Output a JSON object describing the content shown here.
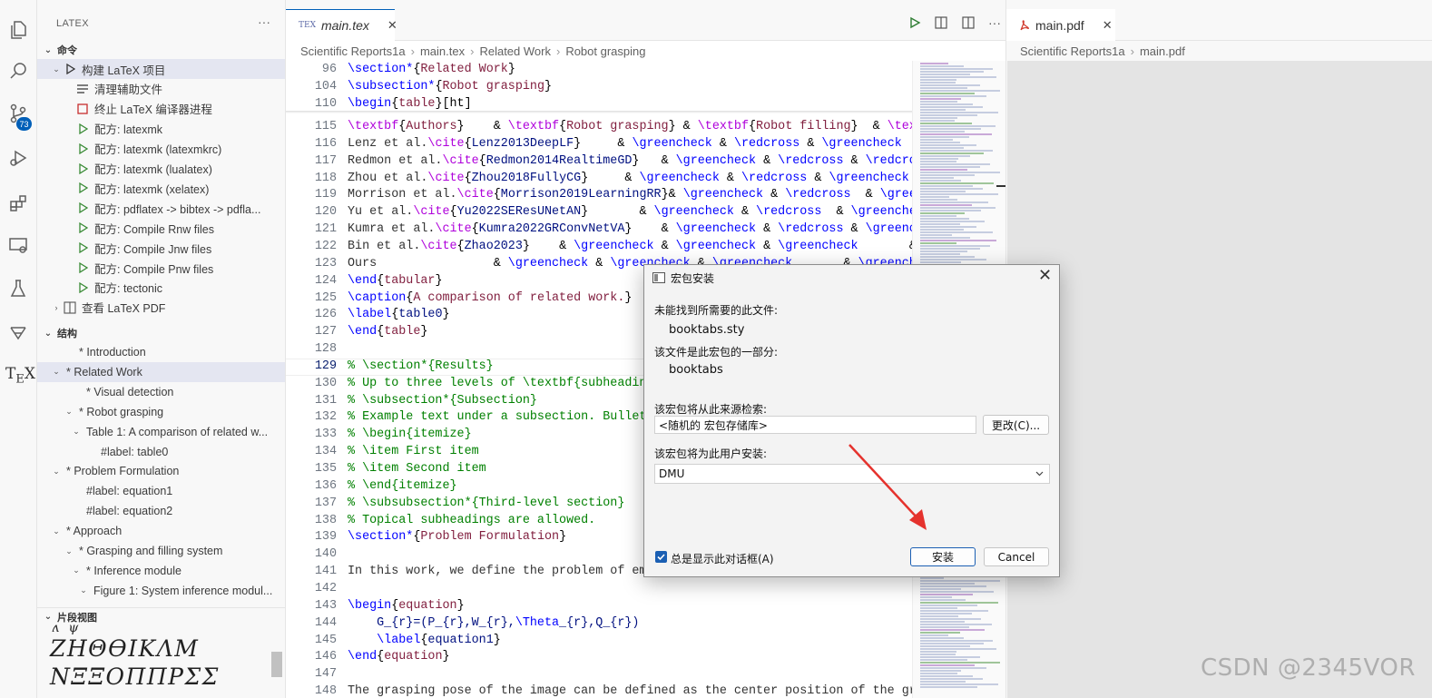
{
  "sidebar": {
    "title": "LATEX",
    "more": "···",
    "badge": "73",
    "commands_header": "命令",
    "commands": [
      {
        "label": "构建 LaTeX 项目",
        "icon": "play-outline-icon"
      },
      {
        "label": "清理辅助文件",
        "icon": "list-icon"
      },
      {
        "label": "终止 LaTeX 编译器进程",
        "icon": "stop-icon"
      },
      {
        "label": "配方: latexmk",
        "icon": "play-icon"
      },
      {
        "label": "配方: latexmk (latexmkrc)",
        "icon": "play-icon"
      },
      {
        "label": "配方: latexmk (lualatex)",
        "icon": "play-icon"
      },
      {
        "label": "配方: latexmk (xelatex)",
        "icon": "play-icon"
      },
      {
        "label": "配方: pdflatex -> bibtex -> pdfla...",
        "icon": "play-icon"
      },
      {
        "label": "配方: Compile Rnw files",
        "icon": "play-icon"
      },
      {
        "label": "配方: Compile Jnw files",
        "icon": "play-icon"
      },
      {
        "label": "配方: Compile Pnw files",
        "icon": "play-icon"
      },
      {
        "label": "配方: tectonic",
        "icon": "play-icon"
      },
      {
        "label": "查看 LaTeX PDF",
        "icon": "pdf-view-icon"
      }
    ],
    "structure_header": "结构",
    "structure": [
      {
        "label": "* Introduction"
      },
      {
        "label": "* Related Work"
      },
      {
        "label": "* Visual detection"
      },
      {
        "label": "* Robot grasping"
      },
      {
        "label": "Table 1: A comparison of related w..."
      },
      {
        "label": "#label: table0"
      },
      {
        "label": "* Problem Formulation"
      },
      {
        "label": "#label: equation1"
      },
      {
        "label": "#label: equation2"
      },
      {
        "label": "* Approach"
      },
      {
        "label": "* Grasping and filling system"
      },
      {
        "label": "* Inference module"
      },
      {
        "label": "Figure 1: System inference modul..."
      }
    ],
    "snippet_header": "片段视图",
    "snippet_row1": "ʌ ψ ˜ ˆ ˘ ˙ ˇ ¯ ¯ ˜",
    "snippet_row2": "ZHΘϴIKΛM",
    "snippet_row3": "NΞΞOΠΠΡΣΣ"
  },
  "editor": {
    "tab_label": "main.tex",
    "tab_tex": "TEX",
    "close": "✕",
    "toolbar_more": "···",
    "breadcrumb": [
      "Scientific Reports1a",
      "main.tex",
      "Related Work",
      "Robot grasping"
    ],
    "sticky": [
      {
        "n": "96",
        "parts": [
          [
            "\\section*",
            "k"
          ],
          [
            "{",
            "pl"
          ],
          [
            "Related Work",
            "b"
          ],
          [
            "}",
            "pl"
          ]
        ]
      },
      {
        "n": "104",
        "parts": [
          [
            "\\subsection*",
            "k"
          ],
          [
            "{",
            "pl"
          ],
          [
            "Robot grasping",
            "b"
          ],
          [
            "}",
            "pl"
          ]
        ]
      },
      {
        "n": "110",
        "parts": [
          [
            "\\begin",
            "k"
          ],
          [
            "{",
            "pl"
          ],
          [
            "table",
            "b"
          ],
          [
            "}[ht]",
            "pl"
          ]
        ]
      }
    ],
    "lines": [
      {
        "n": "115",
        "parts": [
          [
            "\\textbf",
            "m"
          ],
          [
            "{",
            "pl"
          ],
          [
            "Authors",
            "b"
          ],
          [
            "}    & ",
            "pl"
          ],
          [
            "\\textbf",
            "m"
          ],
          [
            "{",
            "pl"
          ],
          [
            "Robot grasping",
            "b"
          ],
          [
            "} & ",
            "pl"
          ],
          [
            "\\textbf",
            "m"
          ],
          [
            "{",
            "pl"
          ],
          [
            "Robot filling",
            "b"
          ],
          [
            "}  & ",
            "pl"
          ],
          [
            "\\textbf",
            "m"
          ],
          [
            "{",
            "pl"
          ]
        ]
      },
      {
        "n": "116",
        "parts": [
          [
            "Lenz et al.",
            "txt"
          ],
          [
            "\\cite",
            "m"
          ],
          [
            "{",
            "pl"
          ],
          [
            "Lenz2013DeepLF",
            "a"
          ],
          [
            "}     & ",
            "pl"
          ],
          [
            "\\greencheck",
            "k"
          ],
          [
            " & ",
            "pl"
          ],
          [
            "\\redcross",
            "k"
          ],
          [
            " & ",
            "pl"
          ],
          [
            "\\greencheck",
            "k"
          ]
        ]
      },
      {
        "n": "117",
        "parts": [
          [
            "Redmon et al.",
            "txt"
          ],
          [
            "\\cite",
            "m"
          ],
          [
            "{",
            "pl"
          ],
          [
            "Redmon2014RealtimeGD",
            "a"
          ],
          [
            "}   & ",
            "pl"
          ],
          [
            "\\greencheck",
            "k"
          ],
          [
            " & ",
            "pl"
          ],
          [
            "\\redcross",
            "k"
          ],
          [
            " & ",
            "pl"
          ],
          [
            "\\redcross",
            "k"
          ]
        ]
      },
      {
        "n": "118",
        "parts": [
          [
            "Zhou et al.",
            "txt"
          ],
          [
            "\\cite",
            "m"
          ],
          [
            "{",
            "pl"
          ],
          [
            "Zhou2018FullyCG",
            "a"
          ],
          [
            "}     & ",
            "pl"
          ],
          [
            "\\greencheck",
            "k"
          ],
          [
            " & ",
            "pl"
          ],
          [
            "\\redcross",
            "k"
          ],
          [
            " & ",
            "pl"
          ],
          [
            "\\greencheck",
            "k"
          ]
        ]
      },
      {
        "n": "119",
        "parts": [
          [
            "Morrison et al.",
            "txt"
          ],
          [
            "\\cite",
            "m"
          ],
          [
            "{",
            "pl"
          ],
          [
            "Morrison2019LearningRR",
            "a"
          ],
          [
            "}& ",
            "pl"
          ],
          [
            "\\greencheck",
            "k"
          ],
          [
            " & ",
            "pl"
          ],
          [
            "\\redcross",
            "k"
          ],
          [
            "  & ",
            "pl"
          ],
          [
            "\\greencheck",
            "k"
          ]
        ]
      },
      {
        "n": "120",
        "parts": [
          [
            "Yu et al.",
            "txt"
          ],
          [
            "\\cite",
            "m"
          ],
          [
            "{",
            "pl"
          ],
          [
            "Yu2022SEResUNetAN",
            "a"
          ],
          [
            "}       & ",
            "pl"
          ],
          [
            "\\greencheck",
            "k"
          ],
          [
            " & ",
            "pl"
          ],
          [
            "\\redcross",
            "k"
          ],
          [
            "  & ",
            "pl"
          ],
          [
            "\\greencheck",
            "k"
          ]
        ]
      },
      {
        "n": "121",
        "parts": [
          [
            "Kumra et al.",
            "txt"
          ],
          [
            "\\cite",
            "m"
          ],
          [
            "{",
            "pl"
          ],
          [
            "Kumra2022GRConvNetVA",
            "a"
          ],
          [
            "}    & ",
            "pl"
          ],
          [
            "\\greencheck",
            "k"
          ],
          [
            " & ",
            "pl"
          ],
          [
            "\\redcross",
            "k"
          ],
          [
            " & ",
            "pl"
          ],
          [
            "\\greencheck",
            "k"
          ]
        ]
      },
      {
        "n": "122",
        "parts": [
          [
            "Bin et al.",
            "txt"
          ],
          [
            "\\cite",
            "m"
          ],
          [
            "{",
            "pl"
          ],
          [
            "Zhao2023",
            "a"
          ],
          [
            "}    & ",
            "pl"
          ],
          [
            "\\greencheck",
            "k"
          ],
          [
            " & ",
            "pl"
          ],
          [
            "\\greencheck",
            "k"
          ],
          [
            " & ",
            "pl"
          ],
          [
            "\\greencheck",
            "k"
          ],
          [
            "       &",
            "pl"
          ]
        ]
      },
      {
        "n": "123",
        "parts": [
          [
            "Ours                ",
            "txt"
          ],
          [
            "& ",
            "pl"
          ],
          [
            "\\greencheck",
            "k"
          ],
          [
            " & ",
            "pl"
          ],
          [
            "\\greencheck",
            "k"
          ],
          [
            " & ",
            "pl"
          ],
          [
            "\\greencheck",
            "k"
          ],
          [
            "       & ",
            "pl"
          ],
          [
            "\\greencheck",
            "k"
          ]
        ]
      },
      {
        "n": "124",
        "parts": [
          [
            "\\end",
            "k"
          ],
          [
            "{",
            "pl"
          ],
          [
            "tabular",
            "b"
          ],
          [
            "}",
            "pl"
          ]
        ]
      },
      {
        "n": "125",
        "parts": [
          [
            "\\caption",
            "k"
          ],
          [
            "{",
            "pl"
          ],
          [
            "A comparison of related work.",
            "b"
          ],
          [
            "}",
            "pl"
          ]
        ]
      },
      {
        "n": "126",
        "parts": [
          [
            "\\label",
            "k"
          ],
          [
            "{",
            "pl"
          ],
          [
            "table0",
            "a"
          ],
          [
            "}",
            "pl"
          ]
        ]
      },
      {
        "n": "127",
        "parts": [
          [
            "\\end",
            "k"
          ],
          [
            "{",
            "pl"
          ],
          [
            "table",
            "b"
          ],
          [
            "}",
            "pl"
          ]
        ]
      },
      {
        "n": "128",
        "parts": []
      },
      {
        "n": "129",
        "parts": [
          [
            "% \\section*{Results}",
            "c"
          ]
        ]
      },
      {
        "n": "130",
        "parts": [
          [
            "% Up to three levels of \\textbf{subheading} are permitted.",
            "c"
          ]
        ]
      },
      {
        "n": "131",
        "parts": [
          [
            "% \\subsection*{Subsection}",
            "c"
          ]
        ]
      },
      {
        "n": "132",
        "parts": [
          [
            "% Example text under a subsection. Bulleted lists may be used:",
            "c"
          ]
        ]
      },
      {
        "n": "133",
        "parts": [
          [
            "% \\begin{itemize}",
            "c"
          ]
        ]
      },
      {
        "n": "134",
        "parts": [
          [
            "% \\item First item",
            "c"
          ]
        ]
      },
      {
        "n": "135",
        "parts": [
          [
            "% \\item Second item",
            "c"
          ]
        ]
      },
      {
        "n": "136",
        "parts": [
          [
            "% \\end{itemize}",
            "c"
          ]
        ]
      },
      {
        "n": "137",
        "parts": [
          [
            "% \\subsubsection*{Third-level section}",
            "c"
          ]
        ]
      },
      {
        "n": "138",
        "parts": [
          [
            "% Topical subheadings are allowed.",
            "c"
          ]
        ]
      },
      {
        "n": "139",
        "parts": [
          [
            "\\section*",
            "k"
          ],
          [
            "{",
            "pl"
          ],
          [
            "Problem Formulation",
            "b"
          ],
          [
            "}",
            "pl"
          ]
        ]
      },
      {
        "n": "140",
        "parts": []
      },
      {
        "n": "141",
        "parts": [
          [
            "In this work, we define the problem of emulating the grasping",
            "txt"
          ]
        ]
      },
      {
        "n": "142",
        "parts": []
      },
      {
        "n": "143",
        "parts": [
          [
            "\\begin",
            "k"
          ],
          [
            "{",
            "pl"
          ],
          [
            "equation",
            "b"
          ],
          [
            "}",
            "pl"
          ]
        ]
      },
      {
        "n": "144",
        "parts": [
          [
            "    G_{r}=(P_{r},W_{r},",
            "a"
          ],
          [
            "\\Theta",
            "k"
          ],
          [
            "_{r},Q_{r})",
            "a"
          ]
        ]
      },
      {
        "n": "145",
        "parts": [
          [
            "    \\label",
            "k"
          ],
          [
            "{",
            "pl"
          ],
          [
            "equation1",
            "a"
          ],
          [
            "}",
            "pl"
          ]
        ]
      },
      {
        "n": "146",
        "parts": [
          [
            "\\end",
            "k"
          ],
          [
            "{",
            "pl"
          ],
          [
            "equation",
            "b"
          ],
          [
            "}",
            "pl"
          ]
        ]
      },
      {
        "n": "147",
        "parts": []
      },
      {
        "n": "148",
        "parts": [
          [
            "The grasping pose of the image can be defined as the center position of the grasp",
            "txt"
          ]
        ]
      }
    ]
  },
  "pdf": {
    "tab_label": "main.pdf",
    "close": "✕",
    "breadcrumb": [
      "Scientific Reports1a",
      "main.pdf"
    ]
  },
  "dialog": {
    "title": "宏包安装",
    "close": "✕",
    "not_found_label": "未能找到所需要的此文件:",
    "file_name": "booktabs.sty",
    "part_of_label": "该文件是此宏包的一部分:",
    "package_name": "booktabs",
    "source_label": "该宏包将从此来源检索:",
    "source_value": "<随机的 宏包存储库>",
    "change_button": "更改(C)...",
    "user_label": "该宏包将为此用户安装:",
    "user_value": "DMU",
    "always_show_label": "总是显示此对话框(A)",
    "always_show_checked": true,
    "install_button": "安装",
    "cancel_button": "Cancel"
  },
  "watermark": "CSDN @2345VOR",
  "colors": {
    "accent": "#005fb8",
    "arrow": "#e5322d"
  }
}
